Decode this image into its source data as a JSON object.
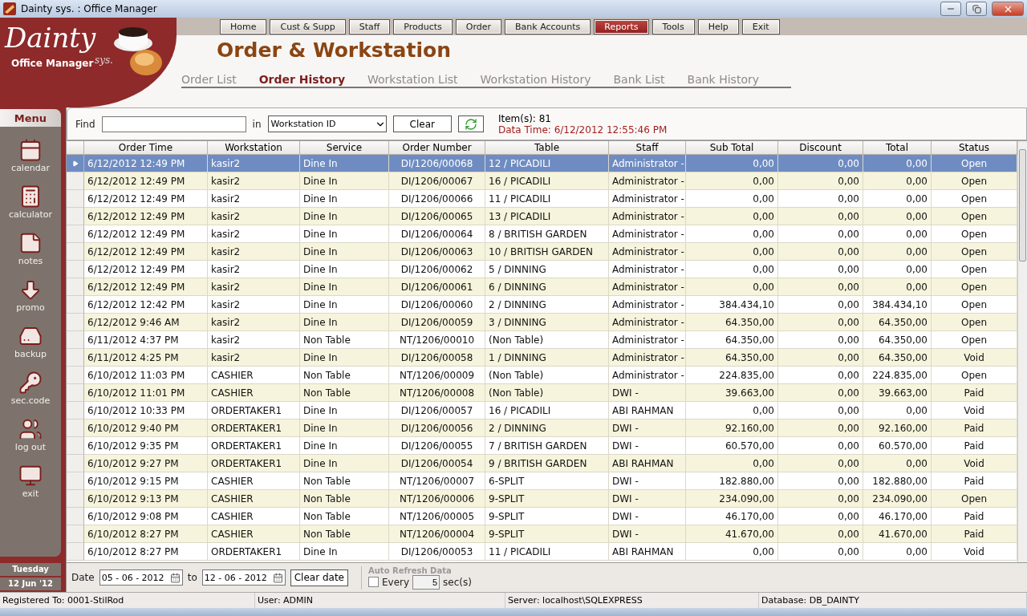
{
  "window": {
    "title": "Dainty sys. : Office Manager"
  },
  "brand": {
    "name": "Dainty",
    "suffix": "sys.",
    "subtitle": "Office Manager"
  },
  "nav": [
    {
      "label": "Home",
      "selected": false
    },
    {
      "label": "Cust & Supp",
      "selected": false
    },
    {
      "label": "Staff",
      "selected": false
    },
    {
      "label": "Products",
      "selected": false
    },
    {
      "label": "Order",
      "selected": false
    },
    {
      "label": "Bank Accounts",
      "selected": false
    },
    {
      "label": "Reports",
      "selected": true
    },
    {
      "label": "Tools",
      "selected": false
    },
    {
      "label": "Help",
      "selected": false
    },
    {
      "label": "Exit",
      "selected": false
    }
  ],
  "page_title": "Order & Workstation",
  "tabs": [
    {
      "label": "Order List",
      "selected": false
    },
    {
      "label": "Order History",
      "selected": true
    },
    {
      "label": "Workstation List",
      "selected": false
    },
    {
      "label": "Workstation History",
      "selected": false
    },
    {
      "label": "Bank List",
      "selected": false
    },
    {
      "label": "Bank History",
      "selected": false
    }
  ],
  "sidebar": {
    "title": "Menu",
    "items": [
      {
        "label": "calendar",
        "kind": "calendar"
      },
      {
        "label": "calculator",
        "kind": "calculator"
      },
      {
        "label": "notes",
        "kind": "notes"
      },
      {
        "label": "promo",
        "kind": "promo"
      },
      {
        "label": "backup",
        "kind": "backup"
      },
      {
        "label": "sec.code",
        "kind": "keys"
      },
      {
        "label": "log out",
        "kind": "logout"
      },
      {
        "label": "exit",
        "kind": "exit"
      }
    ],
    "day": "Tuesday",
    "date": "12 Jun '12"
  },
  "toolbar": {
    "find_label": "Find",
    "in_label": "in",
    "in_value": "Workstation ID",
    "clear": "Clear",
    "items": "Item(s): 81",
    "data_time": "Data Time: 6/12/2012 12:55:46 PM"
  },
  "table": {
    "columns": [
      "Order Time",
      "Workstation",
      "Service",
      "Order Number",
      "Table",
      "Staff",
      "Sub Total",
      "Discount",
      "Total",
      "Status"
    ],
    "rows": [
      {
        "selected": true,
        "cells": [
          "6/12/2012 12:49 PM",
          "kasir2",
          "Dine In",
          "DI/1206/00068",
          "12 / PICADILI",
          "Administrator -",
          "0,00",
          "0,00",
          "0,00",
          "Open"
        ]
      },
      {
        "selected": false,
        "cells": [
          "6/12/2012 12:49 PM",
          "kasir2",
          "Dine In",
          "DI/1206/00067",
          "16 / PICADILI",
          "Administrator -",
          "0,00",
          "0,00",
          "0,00",
          "Open"
        ]
      },
      {
        "selected": false,
        "cells": [
          "6/12/2012 12:49 PM",
          "kasir2",
          "Dine In",
          "DI/1206/00066",
          "11 / PICADILI",
          "Administrator -",
          "0,00",
          "0,00",
          "0,00",
          "Open"
        ]
      },
      {
        "selected": false,
        "cells": [
          "6/12/2012 12:49 PM",
          "kasir2",
          "Dine In",
          "DI/1206/00065",
          "13 / PICADILI",
          "Administrator -",
          "0,00",
          "0,00",
          "0,00",
          "Open"
        ]
      },
      {
        "selected": false,
        "cells": [
          "6/12/2012 12:49 PM",
          "kasir2",
          "Dine In",
          "DI/1206/00064",
          "8 / BRITISH GARDEN",
          "Administrator -",
          "0,00",
          "0,00",
          "0,00",
          "Open"
        ]
      },
      {
        "selected": false,
        "cells": [
          "6/12/2012 12:49 PM",
          "kasir2",
          "Dine In",
          "DI/1206/00063",
          "10 / BRITISH GARDEN",
          "Administrator -",
          "0,00",
          "0,00",
          "0,00",
          "Open"
        ]
      },
      {
        "selected": false,
        "cells": [
          "6/12/2012 12:49 PM",
          "kasir2",
          "Dine In",
          "DI/1206/00062",
          "5 / DINNING",
          "Administrator -",
          "0,00",
          "0,00",
          "0,00",
          "Open"
        ]
      },
      {
        "selected": false,
        "cells": [
          "6/12/2012 12:49 PM",
          "kasir2",
          "Dine In",
          "DI/1206/00061",
          "6 / DINNING",
          "Administrator -",
          "0,00",
          "0,00",
          "0,00",
          "Open"
        ]
      },
      {
        "selected": false,
        "cells": [
          "6/12/2012 12:42 PM",
          "kasir2",
          "Dine In",
          "DI/1206/00060",
          "2 / DINNING",
          "Administrator -",
          "384.434,10",
          "0,00",
          "384.434,10",
          "Open"
        ]
      },
      {
        "selected": false,
        "cells": [
          "6/12/2012 9:46 AM",
          "kasir2",
          "Dine In",
          "DI/1206/00059",
          "3 / DINNING",
          "Administrator -",
          "64.350,00",
          "0,00",
          "64.350,00",
          "Open"
        ]
      },
      {
        "selected": false,
        "cells": [
          "6/11/2012 4:37 PM",
          "kasir2",
          "Non Table",
          "NT/1206/00010",
          "(Non Table)",
          "Administrator -",
          "64.350,00",
          "0,00",
          "64.350,00",
          "Open"
        ]
      },
      {
        "selected": false,
        "cells": [
          "6/11/2012 4:25 PM",
          "kasir2",
          "Dine In",
          "DI/1206/00058",
          "1 / DINNING",
          "Administrator -",
          "64.350,00",
          "0,00",
          "64.350,00",
          "Void"
        ]
      },
      {
        "selected": false,
        "cells": [
          "6/10/2012 11:03 PM",
          "CASHIER",
          "Non Table",
          "NT/1206/00009",
          "(Non Table)",
          "Administrator -",
          "224.835,00",
          "0,00",
          "224.835,00",
          "Open"
        ]
      },
      {
        "selected": false,
        "cells": [
          "6/10/2012 11:01 PM",
          "CASHIER",
          "Non Table",
          "NT/1206/00008",
          "(Non Table)",
          "DWI -",
          "39.663,00",
          "0,00",
          "39.663,00",
          "Paid"
        ]
      },
      {
        "selected": false,
        "cells": [
          "6/10/2012 10:33 PM",
          "ORDERTAKER1",
          "Dine In",
          "DI/1206/00057",
          "16 / PICADILI",
          "ABI RAHMAN",
          "0,00",
          "0,00",
          "0,00",
          "Void"
        ]
      },
      {
        "selected": false,
        "cells": [
          "6/10/2012 9:40 PM",
          "ORDERTAKER1",
          "Dine In",
          "DI/1206/00056",
          "2 / DINNING",
          "DWI -",
          "92.160,00",
          "0,00",
          "92.160,00",
          "Paid"
        ]
      },
      {
        "selected": false,
        "cells": [
          "6/10/2012 9:35 PM",
          "ORDERTAKER1",
          "Dine In",
          "DI/1206/00055",
          "7 / BRITISH GARDEN",
          "DWI -",
          "60.570,00",
          "0,00",
          "60.570,00",
          "Paid"
        ]
      },
      {
        "selected": false,
        "cells": [
          "6/10/2012 9:27 PM",
          "ORDERTAKER1",
          "Dine In",
          "DI/1206/00054",
          "9 / BRITISH GARDEN",
          "ABI RAHMAN",
          "0,00",
          "0,00",
          "0,00",
          "Void"
        ]
      },
      {
        "selected": false,
        "cells": [
          "6/10/2012 9:15 PM",
          "CASHIER",
          "Non Table",
          "NT/1206/00007",
          "6-SPLIT",
          "DWI -",
          "182.880,00",
          "0,00",
          "182.880,00",
          "Paid"
        ]
      },
      {
        "selected": false,
        "cells": [
          "6/10/2012 9:13 PM",
          "CASHIER",
          "Non Table",
          "NT/1206/00006",
          "9-SPLIT",
          "DWI -",
          "234.090,00",
          "0,00",
          "234.090,00",
          "Open"
        ]
      },
      {
        "selected": false,
        "cells": [
          "6/10/2012 9:08 PM",
          "CASHIER",
          "Non Table",
          "NT/1206/00005",
          "9-SPLIT",
          "DWI -",
          "46.170,00",
          "0,00",
          "46.170,00",
          "Paid"
        ]
      },
      {
        "selected": false,
        "cells": [
          "6/10/2012 8:27 PM",
          "CASHIER",
          "Non Table",
          "NT/1206/00004",
          "9-SPLIT",
          "DWI -",
          "41.670,00",
          "0,00",
          "41.670,00",
          "Paid"
        ]
      },
      {
        "selected": false,
        "cells": [
          "6/10/2012 8:27 PM",
          "ORDERTAKER1",
          "Dine In",
          "DI/1206/00053",
          "11 / PICADILI",
          "ABI RAHMAN",
          "0,00",
          "0,00",
          "0,00",
          "Void"
        ]
      }
    ]
  },
  "date_bar": {
    "label": "Date",
    "from": "05 - 06 - 2012",
    "to_label": "to",
    "to": "12 - 06 - 2012",
    "clear": "Clear date",
    "auto_refresh": {
      "title": "Auto Refresh Data",
      "label": "Every",
      "checked": false,
      "value": "5",
      "unit": "sec(s)"
    }
  },
  "status_bar": [
    "Registered To: 0001-StilRod",
    "User: ADMIN",
    "Server: localhost\\SQLEXPRESS",
    "Database: DB_DAINTY"
  ]
}
